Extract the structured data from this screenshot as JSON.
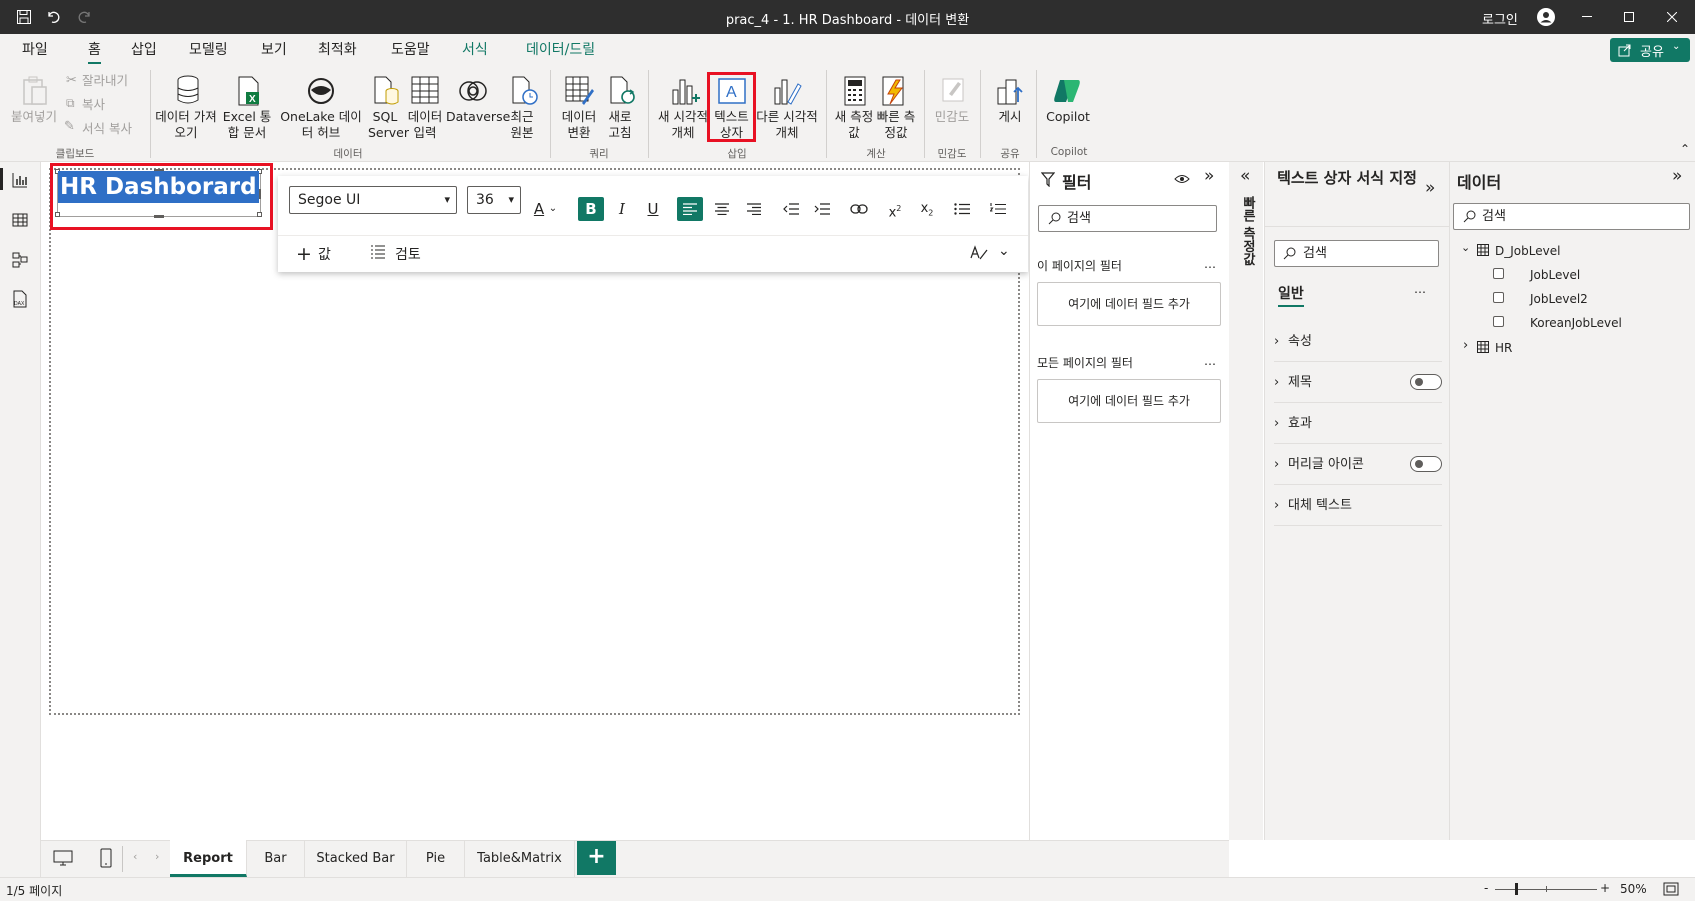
{
  "window": {
    "title": "prac_4 - 1. HR Dashboard - 데이터 변환",
    "login": "로그인"
  },
  "menu": {
    "items": [
      "파일",
      "홈",
      "삽입",
      "모델링",
      "보기",
      "최적화",
      "도움말",
      "서식",
      "데이터/드릴"
    ],
    "share": "공유"
  },
  "ribbon": {
    "clipboard": {
      "paste": "붙여넣기",
      "cut": "잘라내기",
      "copy": "복사",
      "format_copy": "서식 복사",
      "group": "클립보드"
    },
    "data": {
      "get_data": "데이터 가져오기",
      "excel": "Excel 통합 문서",
      "onelake": "OneLake 데이터 허브",
      "sql": "SQL Server",
      "enter": "데이터 입력",
      "dataverse": "Dataverse",
      "recent": "최근 원본",
      "group": "데이터"
    },
    "query": {
      "transform": "데이터 변환",
      "refresh": "새로 고침",
      "group": "쿼리"
    },
    "insert": {
      "new_visual": "새 시각적 개체",
      "textbox": "텍스트 상자",
      "more_visuals": "다른 시각적 개체",
      "group": "삽입"
    },
    "calc": {
      "new_measure": "새 측정값",
      "quick_measure": "빠른 측정값",
      "group": "계산"
    },
    "sensitivity": {
      "label": "민감도",
      "group": "민감도"
    },
    "share": {
      "publish": "게시",
      "group": "공유"
    },
    "copilot": {
      "label": "Copilot",
      "group": "Copilot"
    }
  },
  "textbox": {
    "text": "HR Dashborard",
    "font": "Segoe UI",
    "size": "36",
    "value_btn": "값",
    "review_btn": "검토"
  },
  "filters": {
    "title": "필터",
    "search": "검색",
    "this_page": "이 페이지의 필터",
    "all_pages": "모든 페이지의 필터",
    "add_field": "여기에 데이터 필드 추가",
    "more": "…"
  },
  "quick_measure_tab": "빠른 측정값",
  "format": {
    "title": "텍스트 상자 서식 지정",
    "search": "검색",
    "tab": "일반",
    "more": "…",
    "sections": [
      "속성",
      "제목",
      "효과",
      "머리글 아이콘",
      "대체 텍스트"
    ]
  },
  "data": {
    "title": "데이터",
    "search": "검색",
    "tables": [
      {
        "name": "D_JobLevel",
        "fields": [
          "JobLevel",
          "JobLevel2",
          "KoreanJobLevel"
        ]
      },
      {
        "name": "HR"
      }
    ]
  },
  "tabs": [
    "Report",
    "Bar",
    "Stacked Bar",
    "Pie",
    "Table&Matrix"
  ],
  "status": {
    "page": "1/5 페이지",
    "zoom": "50%"
  },
  "colors": {
    "accent": "#117865",
    "highlight": "#e81123",
    "selection": "#2f6fc6"
  }
}
